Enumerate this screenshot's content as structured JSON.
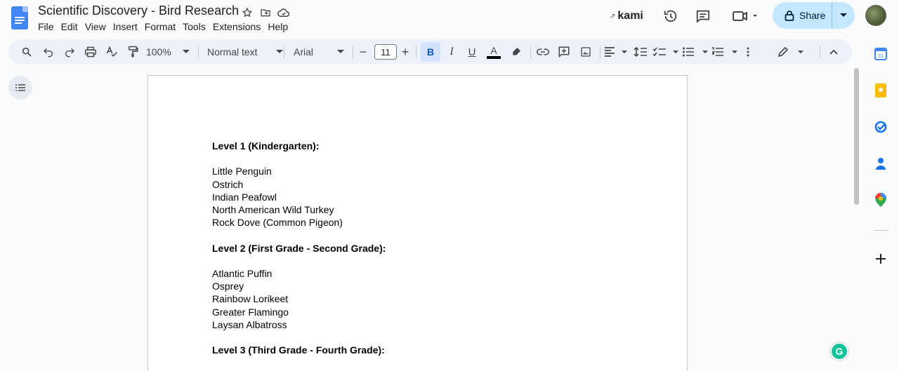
{
  "doc": {
    "title": "Scientific Discovery - Bird Research"
  },
  "menu": [
    "File",
    "Edit",
    "View",
    "Insert",
    "Format",
    "Tools",
    "Extensions",
    "Help"
  ],
  "topbar": {
    "kami_label": "kami",
    "share_label": "Share"
  },
  "toolbar": {
    "zoom": "100%",
    "style": "Normal text",
    "font": "Arial",
    "font_size": "11",
    "decrease": "−",
    "increase": "+"
  },
  "content": {
    "sections": [
      {
        "heading": "Level 1 (Kindergarten):",
        "items": [
          "Little Penguin",
          "Ostrich",
          "Indian Peafowl",
          "North American Wild Turkey",
          "Rock Dove (Common Pigeon)"
        ]
      },
      {
        "heading": "Level 2 (First Grade - Second Grade):",
        "items": [
          "Atlantic Puffin",
          "Osprey",
          "Rainbow Lorikeet",
          "Greater Flamingo",
          "Laysan Albatross"
        ]
      },
      {
        "heading": "Level 3 (Third Grade - Fourth Grade):",
        "items": []
      }
    ]
  },
  "colors": {
    "accent": "#0b57d0",
    "share_bg": "#c2e7ff",
    "toolbar_bg": "#edf2fa",
    "docs_blue": "#4285f4",
    "grammarly": "#15c39a"
  },
  "icons": {
    "star": "star-icon",
    "move": "move-to-folder-icon",
    "cloud": "cloud-status-icon",
    "history": "history-icon",
    "comment": "comment-icon",
    "meet": "video-call-icon",
    "lock": "lock-icon"
  }
}
